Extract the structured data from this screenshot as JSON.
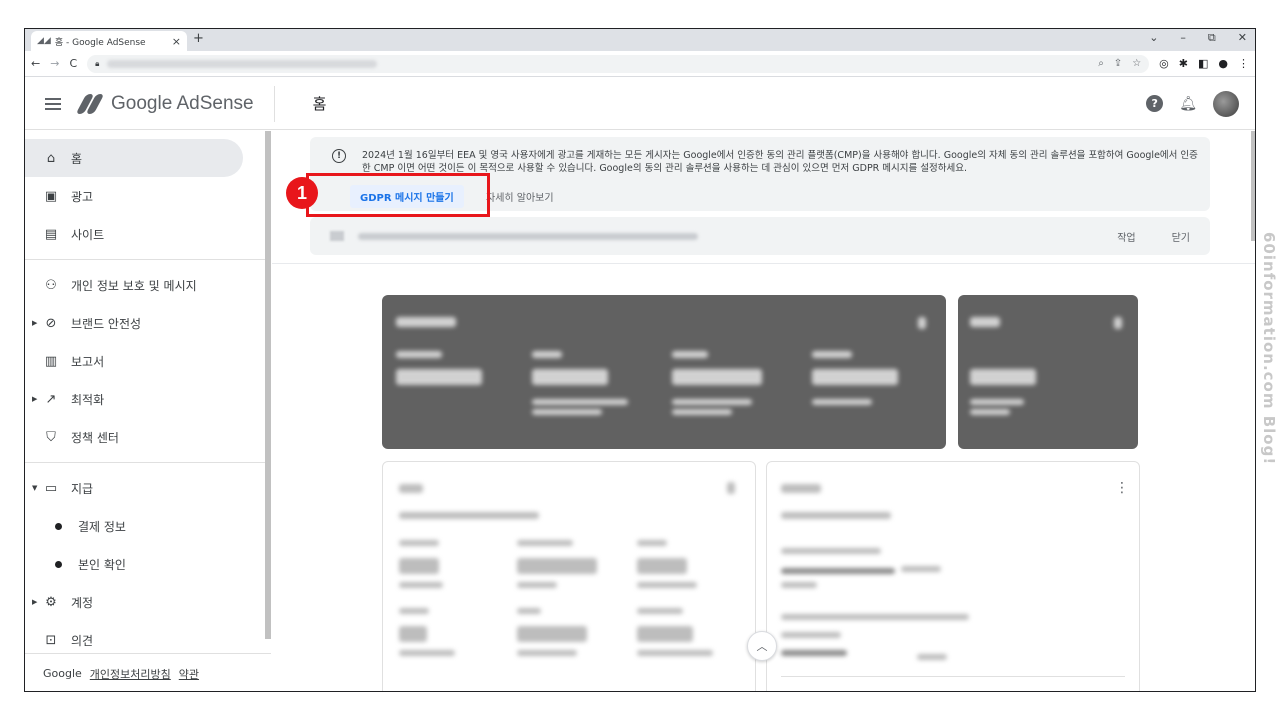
{
  "browser": {
    "tab_title": "홈 - Google AdSense",
    "tab_close": "×",
    "new_tab": "+",
    "window_controls": [
      "⌄",
      "–",
      "⧉",
      "✕"
    ]
  },
  "header": {
    "logo_text": "Google AdSense",
    "page_title": "홈",
    "help": "?"
  },
  "sidebar": {
    "items": [
      {
        "label": "홈",
        "icon": "home-icon"
      },
      {
        "label": "광고",
        "icon": "ads-icon"
      },
      {
        "label": "사이트",
        "icon": "sites-icon"
      },
      {
        "label": "개인 정보 보호 및 메시지",
        "icon": "privacy-icon"
      },
      {
        "label": "브랜드 안전성",
        "icon": "block-icon"
      },
      {
        "label": "보고서",
        "icon": "report-icon"
      },
      {
        "label": "최적화",
        "icon": "trending-icon"
      },
      {
        "label": "정책 센터",
        "icon": "policy-icon"
      },
      {
        "label": "지급",
        "icon": "payments-icon"
      },
      {
        "label": "계정",
        "icon": "gear-icon"
      },
      {
        "label": "의견",
        "icon": "feedback-icon"
      }
    ],
    "payments_sub": [
      "결제 정보",
      "본인 확인"
    ],
    "footer": {
      "brand": "Google",
      "privacy": "개인정보처리방침",
      "terms": "약관"
    }
  },
  "banner": {
    "text": "2024년 1월 16일부터 EEA 및 영국 사용자에게 광고를 게재하는 모든 게시자는 Google에서 인증한 동의 관리 플랫폼(CMP)을 사용해야 합니다. Google의 자체 동의 관리 솔루션을 포함하여 Google에서 인증한 CMP 이면 어떤 것이든 이 목적으로 사용할 수 있습니다. Google의 동의 관리 솔루션을 사용하는 데 관심이 있으면 먼저 GDPR 메시지를 설정하세요.",
    "primary_button": "GDPR 메시지 만들기",
    "learn_more": "자세히 알아보기",
    "step_number": "1"
  },
  "banner2": {
    "action": "작업",
    "dismiss": "닫기"
  },
  "watermark": "60information.com Blog!",
  "colors": {
    "accent": "#1a73e8",
    "annotation": "#e8161b",
    "dark_card": "#616161"
  }
}
